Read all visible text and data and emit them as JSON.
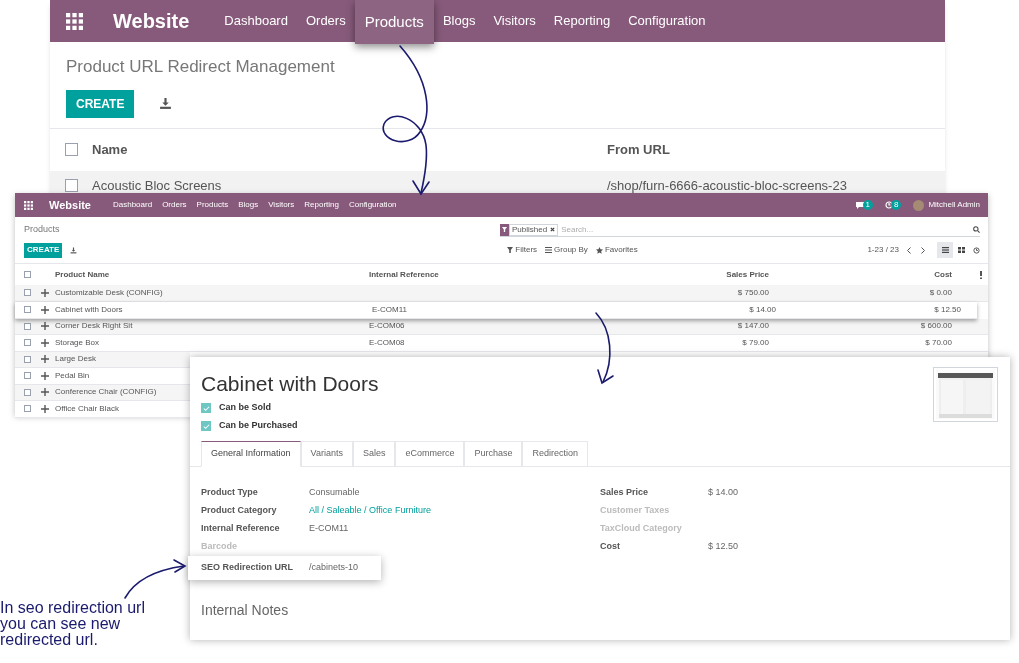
{
  "redirect_window": {
    "app_name": "Website",
    "menu": [
      {
        "label": "Dashboard",
        "selected": false
      },
      {
        "label": "Orders",
        "selected": false
      },
      {
        "label": "Products",
        "selected": true
      },
      {
        "label": "Blogs",
        "selected": false
      },
      {
        "label": "Visitors",
        "selected": false
      },
      {
        "label": "Reporting",
        "selected": false
      },
      {
        "label": "Configuration",
        "selected": false
      }
    ],
    "title": "Product URL Redirect Management",
    "create_button": "CREATE",
    "columns": [
      "Name",
      "From URL"
    ],
    "all_checked": false,
    "rows": [
      {
        "name": "Acoustic Bloc Screens",
        "from_url": "/shop/furn-6666-acoustic-bloc-screens-23",
        "checked": false
      }
    ]
  },
  "product_list": {
    "app_name": "Website",
    "menu": [
      "Dashboard",
      "Orders",
      "Products",
      "Blogs",
      "Visitors",
      "Reporting",
      "Configuration"
    ],
    "message_count": "1",
    "activity_count": "8",
    "user": "Mitchell Admin",
    "breadcrumb": "Products",
    "create_button": "CREATE",
    "search": {
      "facet": "Published",
      "placeholder": "Search..."
    },
    "filters": [
      {
        "label": "Filters",
        "kind": "filter"
      },
      {
        "label": "Group By",
        "kind": "group"
      },
      {
        "label": "Favorites",
        "kind": "star"
      }
    ],
    "pager": "1-23 / 23",
    "columns": [
      "Product Name",
      "Internal Reference",
      "Sales Price",
      "Cost"
    ],
    "all_checked": false,
    "rows": [
      {
        "name": "Customizable Desk (CONFIG)",
        "price": "$ 750.00",
        "cost": "$ 0.00",
        "raised": false,
        "checked": false
      },
      {
        "name": "Cabinet with Doors",
        "ref": "E-COM11",
        "price": "$ 14.00",
        "cost": "$ 12.50",
        "raised": true,
        "checked": false
      },
      {
        "name": "Corner Desk Right Sit",
        "ref": "E-COM06",
        "price": "$ 147.00",
        "cost": "$ 600.00",
        "raised": false,
        "checked": false
      },
      {
        "name": "Storage Box",
        "ref": "E-COM08",
        "price": "$ 79.00",
        "cost": "$ 70.00",
        "raised": false,
        "checked": false
      },
      {
        "name": "Large Desk",
        "raised": false,
        "checked": false
      },
      {
        "name": "Pedal Bin",
        "raised": false,
        "checked": false
      },
      {
        "name": "Conference Chair (CONFIG)",
        "raised": false,
        "checked": false
      },
      {
        "name": "Office Chair Black",
        "raised": false,
        "checked": false
      }
    ]
  },
  "product_form": {
    "title": "Cabinet with Doors",
    "options": [
      {
        "label": "Can be Sold",
        "checked": true
      },
      {
        "label": "Can be Purchased",
        "checked": true
      }
    ],
    "tabs": [
      {
        "label": "General Information",
        "selected": true
      },
      {
        "label": "Variants",
        "selected": false
      },
      {
        "label": "Sales",
        "selected": false
      },
      {
        "label": "eCommerce",
        "selected": false
      },
      {
        "label": "Purchase",
        "selected": false
      },
      {
        "label": "Redirection",
        "selected": false
      }
    ],
    "left_fields": [
      {
        "label": "Product Type",
        "value": "Consumable",
        "highlighted": false
      },
      {
        "label": "Product Category",
        "value": "All / Saleable / Office Furniture",
        "kind": "link",
        "highlighted": false
      },
      {
        "label": "Internal Reference",
        "value": "E-COM11",
        "highlighted": false
      },
      {
        "label": "Barcode",
        "highlighted": false
      },
      {
        "label": "SEO Redirection URL",
        "value": "/cabinets-10",
        "highlighted": true
      }
    ],
    "right_fields": [
      {
        "label": "Sales Price",
        "value": "$ 14.00"
      },
      {
        "label": "Customer Taxes"
      },
      {
        "label": "TaxCloud Category"
      },
      {
        "label": "Cost",
        "value": "$ 12.50"
      }
    ],
    "notes_heading": "Internal Notes"
  },
  "caption": "In seo redirection url you can see new redirected url."
}
